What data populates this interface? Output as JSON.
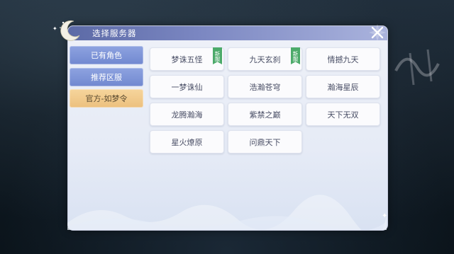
{
  "dialog": {
    "title": "选择服务器"
  },
  "sidebar": {
    "tabs": [
      {
        "label": "已有角色",
        "active": false
      },
      {
        "label": "推荐区服",
        "active": false
      },
      {
        "label": "官方-如梦令",
        "active": true
      }
    ]
  },
  "servers": [
    {
      "name": "梦诛五怪",
      "badge": "新服"
    },
    {
      "name": "九天玄刹",
      "badge": "新服"
    },
    {
      "name": "情撼九天",
      "badge": null
    },
    {
      "name": "一梦诛仙",
      "badge": null
    },
    {
      "name": "浩瀚苍穹",
      "badge": null
    },
    {
      "name": "瀚海星辰",
      "badge": null
    },
    {
      "name": "龙腾瀚海",
      "badge": null
    },
    {
      "name": "紫禁之巅",
      "badge": null
    },
    {
      "name": "天下无双",
      "badge": null
    },
    {
      "name": "星火燎原",
      "badge": null
    },
    {
      "name": "问鼎天下",
      "badge": null
    }
  ],
  "colors": {
    "header": "#6b78b6",
    "tab": "#7f96d8",
    "tab_active": "#f0c888",
    "badge_new": "#4caa6a"
  }
}
